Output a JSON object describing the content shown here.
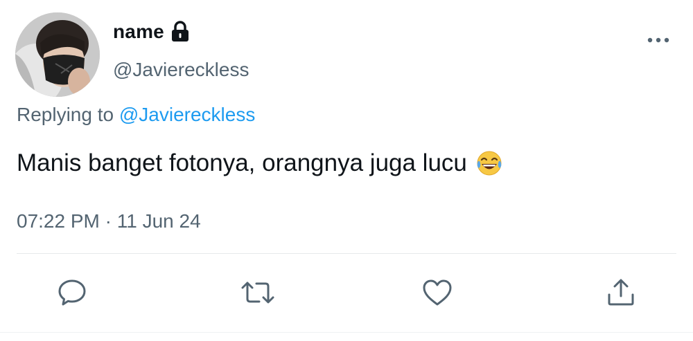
{
  "tweet": {
    "display_name": "name",
    "handle": "@Javiereckless",
    "replying_prefix": "Replying to ",
    "replying_to": "@Javiereckless",
    "text": "Manis banget fotonya, orangnya juga lucu",
    "emoji": "face-with-tears-of-joy",
    "timestamp": "07:22 PM · 11 Jun 24"
  },
  "icons": {
    "lock": "lock-icon",
    "more": "more-icon",
    "reply": "reply-icon",
    "retweet": "retweet-icon",
    "like": "heart-icon",
    "share": "share-icon"
  },
  "colors": {
    "text": "#0f1419",
    "secondary": "#536471",
    "link": "#1d9bf0",
    "divider": "#e6e9eb"
  }
}
